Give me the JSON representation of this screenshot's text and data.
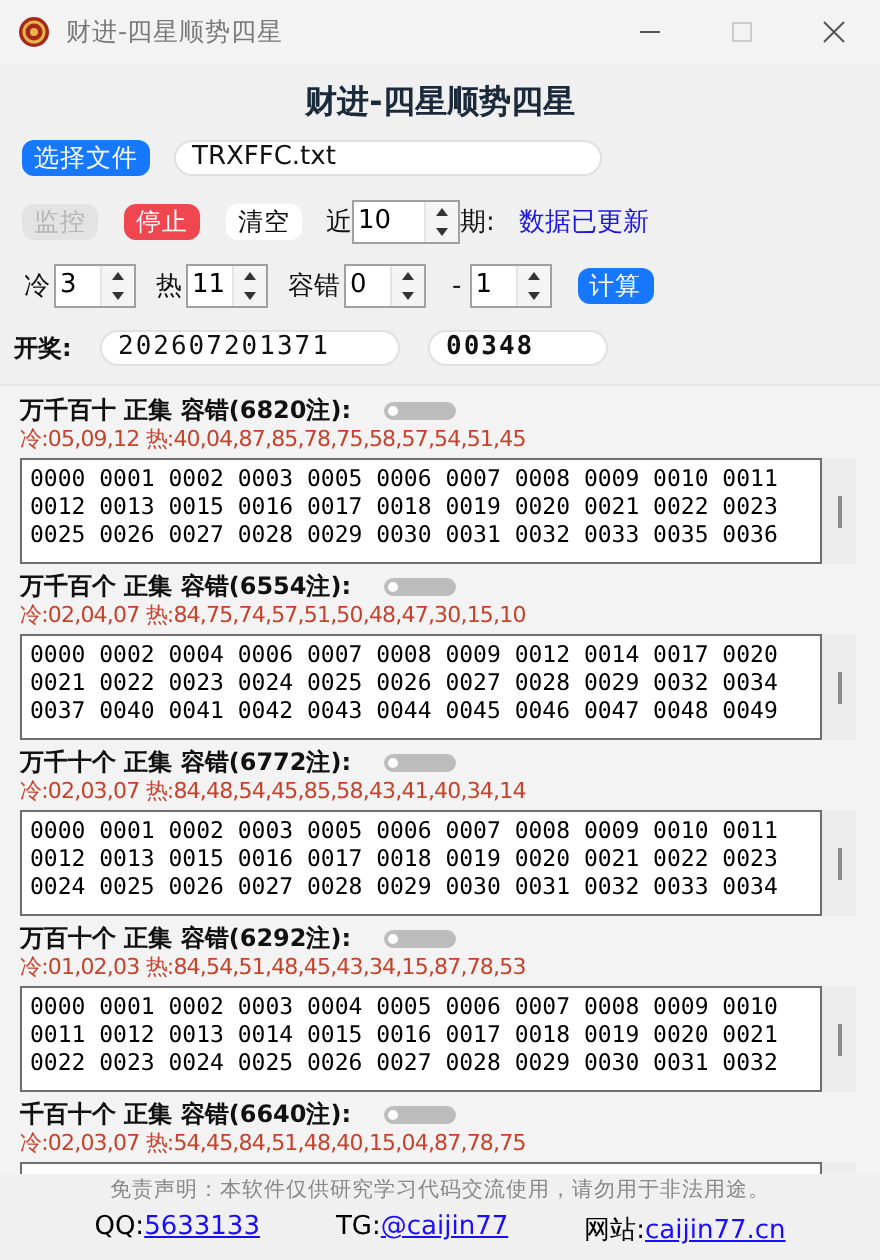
{
  "window": {
    "title": "财进-四星顺势四星"
  },
  "heading": "财进-四星顺势四星",
  "file": {
    "button": "选择文件",
    "value": "TRXFFC.txt"
  },
  "controls": {
    "monitor": {
      "label": "监控",
      "disabled": true
    },
    "stop": "停止",
    "clear": "清空",
    "recent_label": "近",
    "recent_value": "10",
    "period_label": "期:",
    "status": "数据已更新"
  },
  "spinners": [
    {
      "label": "冷",
      "value": "3"
    },
    {
      "label": "热",
      "value": "11"
    },
    {
      "label": "容错",
      "value": "0"
    },
    {
      "label": "-",
      "value": "1"
    }
  ],
  "calc_button": "计算",
  "draw": {
    "label": "开奖:",
    "issue": "202607201371",
    "number": "00348"
  },
  "sections": [
    {
      "title": "万千百十 正集 容错(6820注):",
      "on": false,
      "stats": "冷:05,09,12 热:40,04,87,85,78,75,58,57,54,51,45",
      "lines": [
        "0000 0001 0002 0003 0005 0006 0007 0008 0009 0010 0011",
        "0012 0013 0015 0016 0017 0018 0019 0020 0021 0022 0023",
        "0025 0026 0027 0028 0029 0030 0031 0032 0033 0035 0036"
      ]
    },
    {
      "title": "万千百个 正集 容错(6554注):",
      "on": false,
      "stats": "冷:02,04,07 热:84,75,74,57,51,50,48,47,30,15,10",
      "lines": [
        "0000 0002 0004 0006 0007 0008 0009 0012 0014 0017 0020",
        "0021 0022 0023 0024 0025 0026 0027 0028 0029 0032 0034",
        "0037 0040 0041 0042 0043 0044 0045 0046 0047 0048 0049"
      ]
    },
    {
      "title": "万千十个 正集 容错(6772注):",
      "on": false,
      "stats": "冷:02,03,07 热:84,48,54,45,85,58,43,41,40,34,14",
      "lines": [
        "0000 0001 0002 0003 0005 0006 0007 0008 0009 0010 0011",
        "0012 0013 0015 0016 0017 0018 0019 0020 0021 0022 0023",
        "0024 0025 0026 0027 0028 0029 0030 0031 0032 0033 0034"
      ]
    },
    {
      "title": "万百十个 正集 容错(6292注):",
      "on": false,
      "stats": "冷:01,02,03 热:84,54,51,48,45,43,34,15,87,78,53",
      "lines": [
        "0000 0001 0002 0003 0004 0005 0006 0007 0008 0009 0010",
        "0011 0012 0013 0014 0015 0016 0017 0018 0019 0020 0021",
        "0022 0023 0024 0025 0026 0027 0028 0029 0030 0031 0032"
      ]
    },
    {
      "title": "千百十个 正集 容错(6640注):",
      "on": false,
      "stats": "冷:02,03,07 热:54,45,84,51,48,40,15,04,87,78,75"
    }
  ],
  "disclaimer": "免责声明：本软件仅供研究学习代码交流使用，请勿用于非法用途。",
  "links": [
    {
      "label": "QQ:",
      "link": "5633133"
    },
    {
      "label": "TG:",
      "link": "@caijin77"
    },
    {
      "label": "网站:",
      "link": "caijin77.cn"
    }
  ]
}
